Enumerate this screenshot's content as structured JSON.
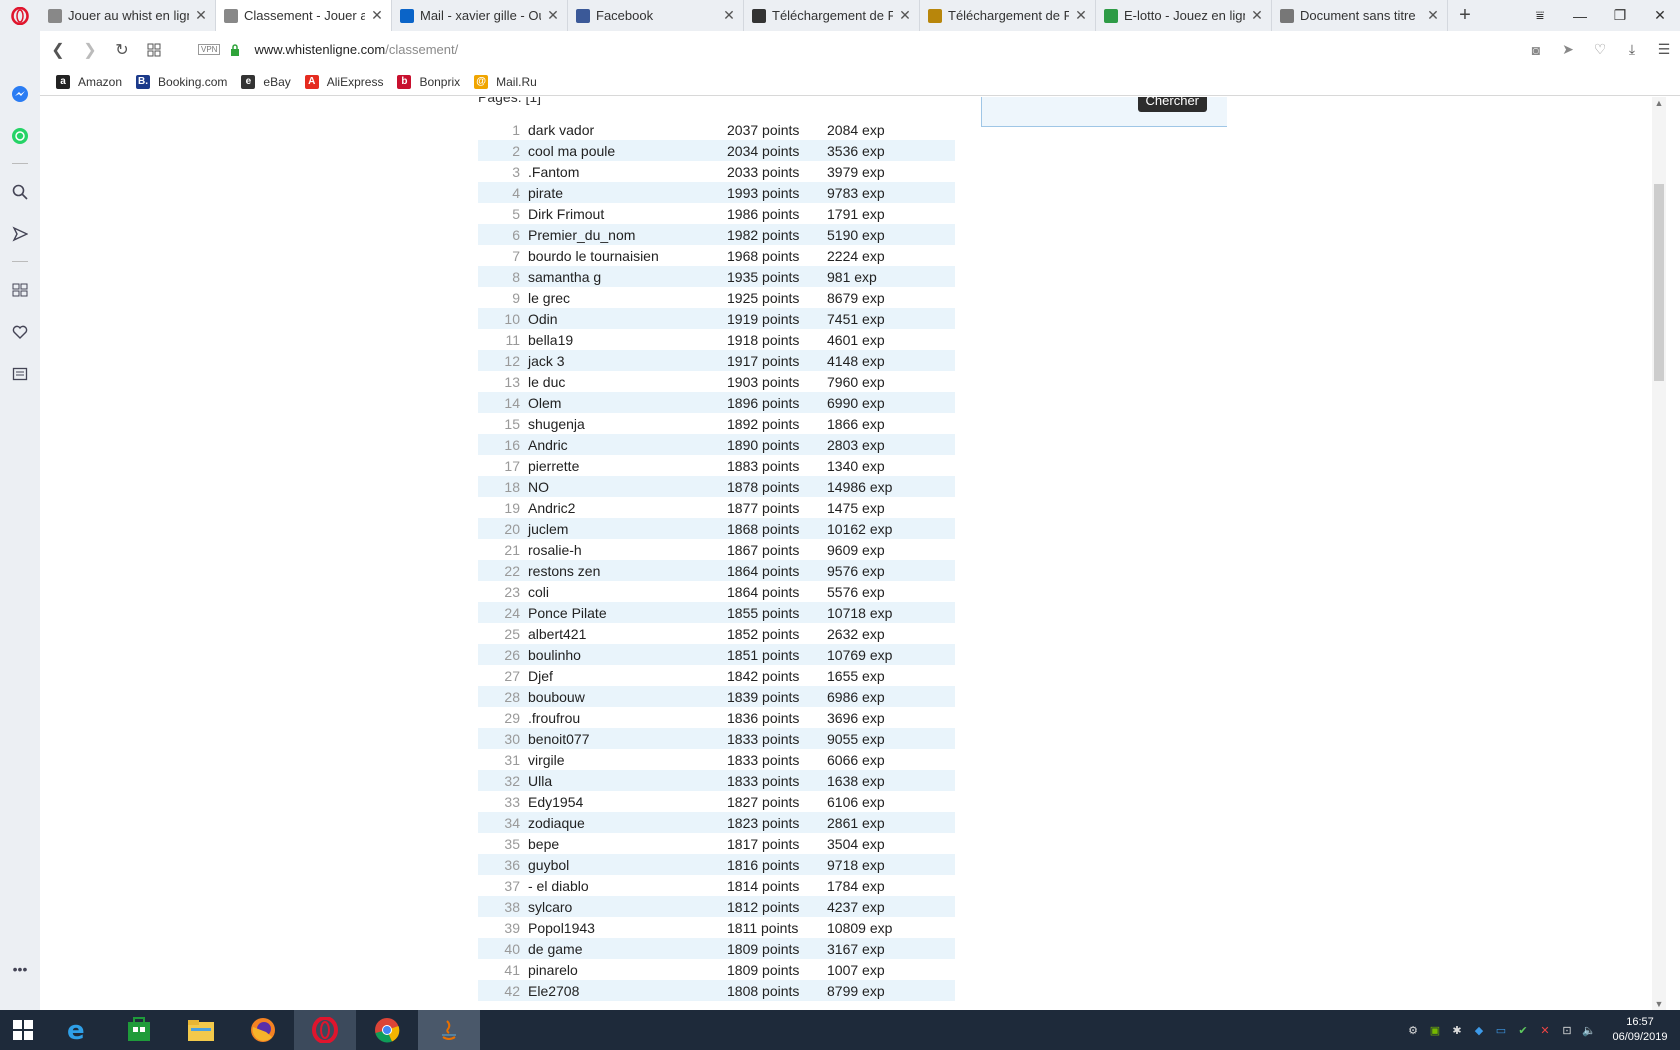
{
  "tabs": [
    {
      "title": "Jouer au whist en ligne",
      "active": false,
      "icon": "whist-favicon"
    },
    {
      "title": "Classement - Jouer au whist",
      "active": true,
      "icon": "whist-favicon"
    },
    {
      "title": "Mail - xavier gille - Outlook",
      "active": false,
      "icon": "outlook-favicon"
    },
    {
      "title": "Facebook",
      "active": false,
      "icon": "facebook-favicon"
    },
    {
      "title": "Téléchargement de Films",
      "active": false,
      "icon": "film-favicon"
    },
    {
      "title": "Téléchargement de Films",
      "active": false,
      "icon": "film-favicon-2"
    },
    {
      "title": "E-lotto - Jouez en ligne",
      "active": false,
      "icon": "elotto-favicon"
    },
    {
      "title": "Document sans titre",
      "active": false,
      "icon": "doc-favicon"
    }
  ],
  "address": {
    "vpn": "VPN",
    "host": "www.whistenligne.com",
    "path": "/classement/"
  },
  "bookmarks": [
    {
      "label": "Amazon",
      "icon": "amazon-icon",
      "color": "#222"
    },
    {
      "label": "Booking.com",
      "icon": "booking-icon",
      "color": "#1b3a8a"
    },
    {
      "label": "eBay",
      "icon": "ebay-icon",
      "color": "#333"
    },
    {
      "label": "AliExpress",
      "icon": "aliexpress-icon",
      "color": "#e52b1f"
    },
    {
      "label": "Bonprix",
      "icon": "bonprix-icon",
      "color": "#c8102e"
    },
    {
      "label": "Mail.Ru",
      "icon": "mailru-icon",
      "color": "#f0a500"
    }
  ],
  "page": {
    "pages_label": "Pages: [1]",
    "search_button": "Chercher"
  },
  "ranking": [
    [
      "1",
      "dark vador",
      "2037 points",
      "2084 exp"
    ],
    [
      "2",
      "cool ma poule",
      "2034 points",
      "3536 exp"
    ],
    [
      "3",
      ".Fantom",
      "2033 points",
      "3979 exp"
    ],
    [
      "4",
      "pirate",
      "1993 points",
      "9783 exp"
    ],
    [
      "5",
      "Dirk Frimout",
      "1986 points",
      "1791 exp"
    ],
    [
      "6",
      "Premier_du_nom",
      "1982 points",
      "5190 exp"
    ],
    [
      "7",
      "bourdo le tournaisien",
      "1968 points",
      "2224 exp"
    ],
    [
      "8",
      "samantha g",
      "1935 points",
      "981 exp"
    ],
    [
      "9",
      "le grec",
      "1925 points",
      "8679 exp"
    ],
    [
      "10",
      "Odin",
      "1919 points",
      "7451 exp"
    ],
    [
      "11",
      "bella19",
      "1918 points",
      "4601 exp"
    ],
    [
      "12",
      "jack 3",
      "1917 points",
      "4148 exp"
    ],
    [
      "13",
      "le duc",
      "1903 points",
      "7960 exp"
    ],
    [
      "14",
      "Olem",
      "1896 points",
      "6990 exp"
    ],
    [
      "15",
      "shugenja",
      "1892 points",
      "1866 exp"
    ],
    [
      "16",
      "Andric",
      "1890 points",
      "2803 exp"
    ],
    [
      "17",
      "pierrette",
      "1883 points",
      "1340 exp"
    ],
    [
      "18",
      "NO",
      "1878 points",
      "14986 exp"
    ],
    [
      "19",
      "Andric2",
      "1877 points",
      "1475 exp"
    ],
    [
      "20",
      "juclem",
      "1868 points",
      "10162 exp"
    ],
    [
      "21",
      "rosalie-h",
      "1867 points",
      "9609 exp"
    ],
    [
      "22",
      "restons zen",
      "1864 points",
      "9576 exp"
    ],
    [
      "23",
      "coli",
      "1864 points",
      "5576 exp"
    ],
    [
      "24",
      "Ponce Pilate",
      "1855 points",
      "10718 exp"
    ],
    [
      "25",
      "albert421",
      "1852 points",
      "2632 exp"
    ],
    [
      "26",
      "boulinho",
      "1851 points",
      "10769 exp"
    ],
    [
      "27",
      "Djef",
      "1842 points",
      "1655 exp"
    ],
    [
      "28",
      "boubouw",
      "1839 points",
      "6986 exp"
    ],
    [
      "29",
      ".froufrou",
      "1836 points",
      "3696 exp"
    ],
    [
      "30",
      "benoit077",
      "1833 points",
      "9055 exp"
    ],
    [
      "31",
      "virgile",
      "1833 points",
      "6066 exp"
    ],
    [
      "32",
      "Ulla",
      "1833 points",
      "1638 exp"
    ],
    [
      "33",
      "Edy1954",
      "1827 points",
      "6106 exp"
    ],
    [
      "34",
      "zodiaque",
      "1823 points",
      "2861 exp"
    ],
    [
      "35",
      "bepe",
      "1817 points",
      "3504 exp"
    ],
    [
      "36",
      "guybol",
      "1816 points",
      "9718 exp"
    ],
    [
      "37",
      "- el diablo",
      "1814 points",
      "1784 exp"
    ],
    [
      "38",
      "sylcaro",
      "1812 points",
      "4237 exp"
    ],
    [
      "39",
      "Popol1943",
      "1811 points",
      "10809 exp"
    ],
    [
      "40",
      "de game",
      "1809 points",
      "3167 exp"
    ],
    [
      "41",
      "pinarelo",
      "1809 points",
      "1007 exp"
    ],
    [
      "42",
      "Ele2708",
      "1808 points",
      "8799 exp"
    ]
  ],
  "taskbar": {
    "time": "16:57",
    "date": "06/09/2019",
    "apps": [
      "start-icon",
      "internet-explorer-icon",
      "store-icon",
      "file-explorer-icon",
      "firefox-icon",
      "opera-icon",
      "chrome-icon",
      "java-icon"
    ]
  },
  "colors": {
    "row_alt": "#e9f4fb",
    "accent_red": "#e0152d"
  }
}
